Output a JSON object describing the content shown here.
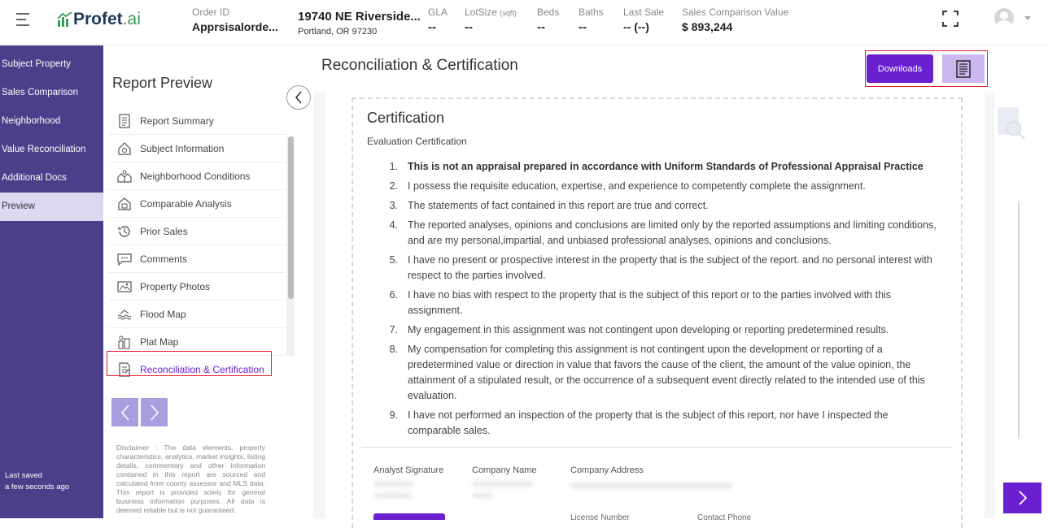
{
  "header": {
    "logo_main": "Profet",
    "logo_suffix": ".ai",
    "order_label": "Order ID",
    "order_value": "Apprsisalorde...",
    "address_line1": "19740 NE Riverside...",
    "address_line2": "Portland, OR 97230",
    "gla_label": "GLA",
    "gla_value": "--",
    "lotsize_label": "LotSize",
    "lotsize_unit": "(sqft)",
    "lotsize_value": "--",
    "beds_label": "Beds",
    "beds_value": "--",
    "baths_label": "Baths",
    "baths_value": "--",
    "lastsale_label": "Last Sale",
    "lastsale_value": "-- (--)",
    "scv_label": "Sales Comparison Value",
    "scv_value": "$ 893,244"
  },
  "nav": {
    "items": [
      {
        "label": "Subject Property",
        "active": false
      },
      {
        "label": "Sales Comparison",
        "active": false
      },
      {
        "label": "Neighborhood",
        "active": false
      },
      {
        "label": "Value Reconciliation",
        "active": false
      },
      {
        "label": "Additional Docs",
        "active": false
      },
      {
        "label": "Preview",
        "active": true
      }
    ],
    "last_saved_label": "Last saved",
    "last_saved_value": "a few seconds ago"
  },
  "report_preview": {
    "title": "Report Preview",
    "items": [
      {
        "label": "Report Summary",
        "icon": "report-summary-icon"
      },
      {
        "label": "Subject Information",
        "icon": "subject-house-icon"
      },
      {
        "label": "Neighborhood Conditions",
        "icon": "neighborhood-icon"
      },
      {
        "label": "Comparable Analysis",
        "icon": "comparable-icon"
      },
      {
        "label": "Prior Sales",
        "icon": "history-icon"
      },
      {
        "label": "Comments",
        "icon": "comment-icon"
      },
      {
        "label": "Property Photos",
        "icon": "photo-icon"
      },
      {
        "label": "Flood Map",
        "icon": "flood-icon"
      },
      {
        "label": "Plat Map",
        "icon": "plat-map-icon"
      },
      {
        "label": "Reconciliation & Certification",
        "icon": "certification-icon"
      }
    ],
    "disclaimer": "Disclaimer : The data elements, property characteristics, analytics, market insights, listing details, commentary and other information contained in this report are sourced and calculated from county assessor and MLS data. This report is provided solely for general business information purposes. All data is deemed reliable but is not guaranteed."
  },
  "main": {
    "title": "Reconciliation & Certification",
    "downloads_label": "Downloads",
    "cert_title": "Certification",
    "cert_subtitle": "Evaluation Certification",
    "items": [
      {
        "num": "1.",
        "text": "This is not an appraisal prepared in accordance with Uniform Standards of Professional Appraisal Practice",
        "bold": true
      },
      {
        "num": "2.",
        "text": "I possess the requisite education, expertise, and experience to competently complete the assignment.",
        "bold": false
      },
      {
        "num": "3.",
        "text": "The statements of fact contained in this report are true and correct.",
        "bold": false
      },
      {
        "num": "4.",
        "text": "The reported analyses, opinions and conclusions are limited only by the reported assumptions and limiting conditions, and are my personal,impartial, and unbiased professional analyses, opinions and conclusions.",
        "bold": false
      },
      {
        "num": "5.",
        "text": "I have no present or prospective interest in the property that is the subject of the report. and no personal interest with respect to the parties involved.",
        "bold": false
      },
      {
        "num": "6.",
        "text": "I have no bias with respect to the property that is the subject of this report or to the parties involved with this assignment.",
        "bold": false
      },
      {
        "num": "7.",
        "text": "My engagement in this assignment was not contingent upon developing or reporting predetermined results.",
        "bold": false
      },
      {
        "num": "8.",
        "text": "My compensation for completing this assignment is not contingent upon the development or reporting of a predetermined value or direction in value that favors the cause of the client, the amount of the value opinion, the attainment of a stipulated result, or the occurrence of a subsequent event directly related to the intended use of this evaluation.",
        "bold": false
      },
      {
        "num": "9.",
        "text": "I have not performed an inspection of the property that is the subject of this report, nor have I inspected the comparable sales.",
        "bold": false
      }
    ],
    "analyst_signature_label": "Analyst Signature",
    "company_name_label": "Company Name",
    "company_address_label": "Company Address",
    "license_number_label": "License Number",
    "contact_phone_label": "Contact Phone"
  },
  "colors": {
    "nav_bg": "#4b3f8a",
    "accent": "#6a1fd0",
    "highlight": "#e0202f"
  }
}
